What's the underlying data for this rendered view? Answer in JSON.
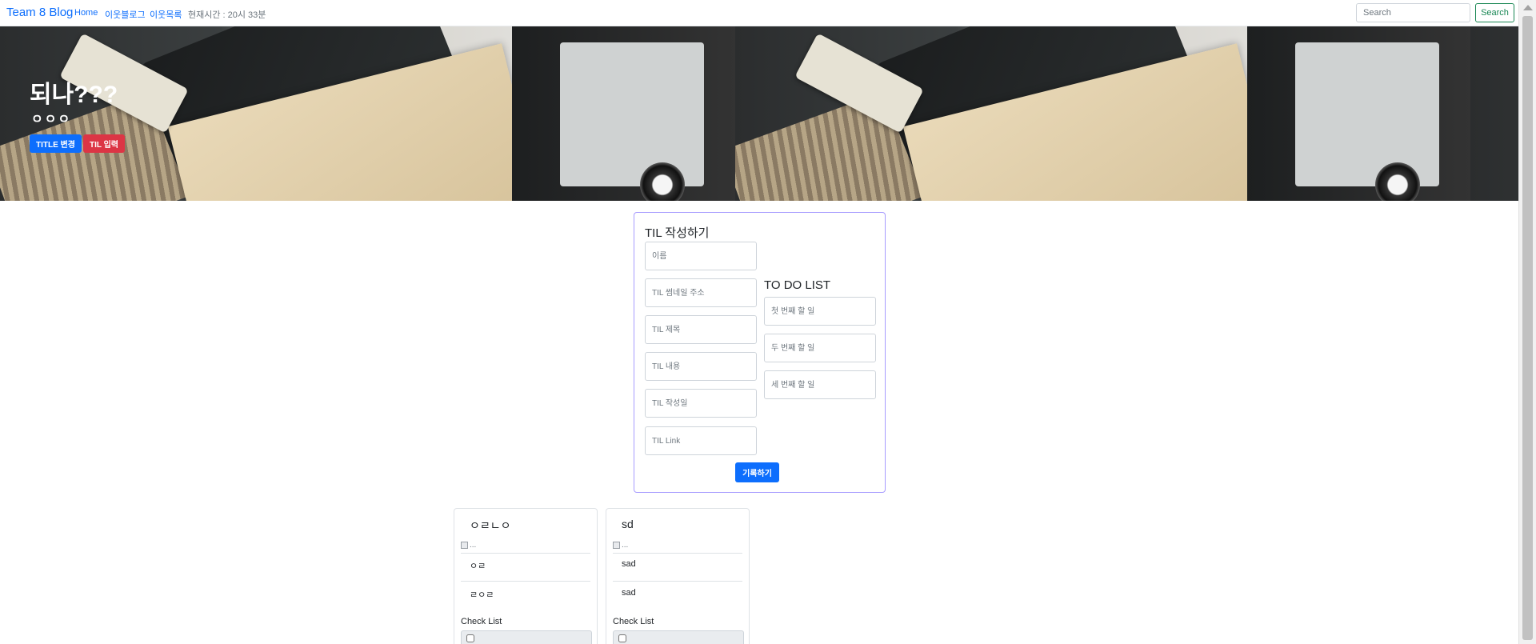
{
  "navbar": {
    "brand": "Team 8 Blog",
    "links": [
      "Home",
      "이웃블로그",
      "이웃목록"
    ],
    "time": "현재시간 : 20시 33분",
    "search_placeholder": "Search",
    "search_button": "Search"
  },
  "hero": {
    "title": "되나???",
    "subtitle": "ㅇㅇㅇ",
    "btn_title_change": "TITLE 변경",
    "btn_til_input": "TIL 입력"
  },
  "form": {
    "title": "TIL 작성하기",
    "fields": [
      "이름",
      "TIL 썸네일 주소",
      "TIL 제목",
      "TIL 내용",
      "TIL 작성일",
      "TIL Link"
    ],
    "todo_title": "TO DO LIST",
    "todos": [
      "첫 번째 할 일",
      "두 번째 할 일",
      "세 번째 할 일"
    ],
    "submit": "기록하기"
  },
  "cards": [
    {
      "title": "ㅇㄹㄴㅇ",
      "img_alt": "...",
      "text1": "ㅇㄹ",
      "text2": "ㄹㅇㄹ",
      "check_label": "Check List"
    },
    {
      "title": "sd",
      "img_alt": "...",
      "text1": "sad",
      "text2": "sad",
      "check_label": "Check List"
    }
  ]
}
